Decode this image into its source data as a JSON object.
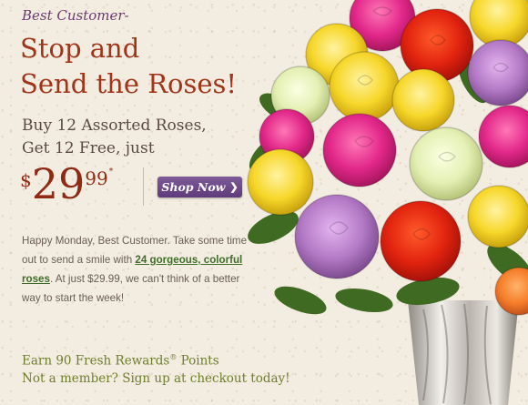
{
  "eyebrow": "Best Customer-",
  "headline": {
    "line1": "Stop and",
    "line2": "Send the Roses!"
  },
  "subhead": {
    "line1": "Buy 12 Assorted Roses,",
    "line2": "Get 12 Free, just"
  },
  "price": {
    "currency": "$",
    "dollars": "29",
    "cents": "99",
    "mark": "*"
  },
  "shop_button": {
    "label": "Shop Now",
    "chevron": "❯"
  },
  "body": {
    "part1": "Happy Monday, Best Customer. Take some time out to send a smile with ",
    "link": "24 gorgeous, colorful roses",
    "part2": ". At just $29.99, we can't think of a better way to start the week!"
  },
  "rewards": {
    "line1_pre": "Earn 90 Fresh Rewards",
    "reg": "®",
    "line1_post": " Points",
    "line2": "Not a member? Sign up at checkout today!"
  },
  "colors": {
    "background": "#f3ece0",
    "headline": "#a0351a",
    "eyebrow": "#6b3a6e",
    "button": "#6b4788",
    "link": "#3f6e2a",
    "rewards": "#6e7f2c"
  },
  "icons": {
    "button_chevron": "chevron-right-icon"
  }
}
